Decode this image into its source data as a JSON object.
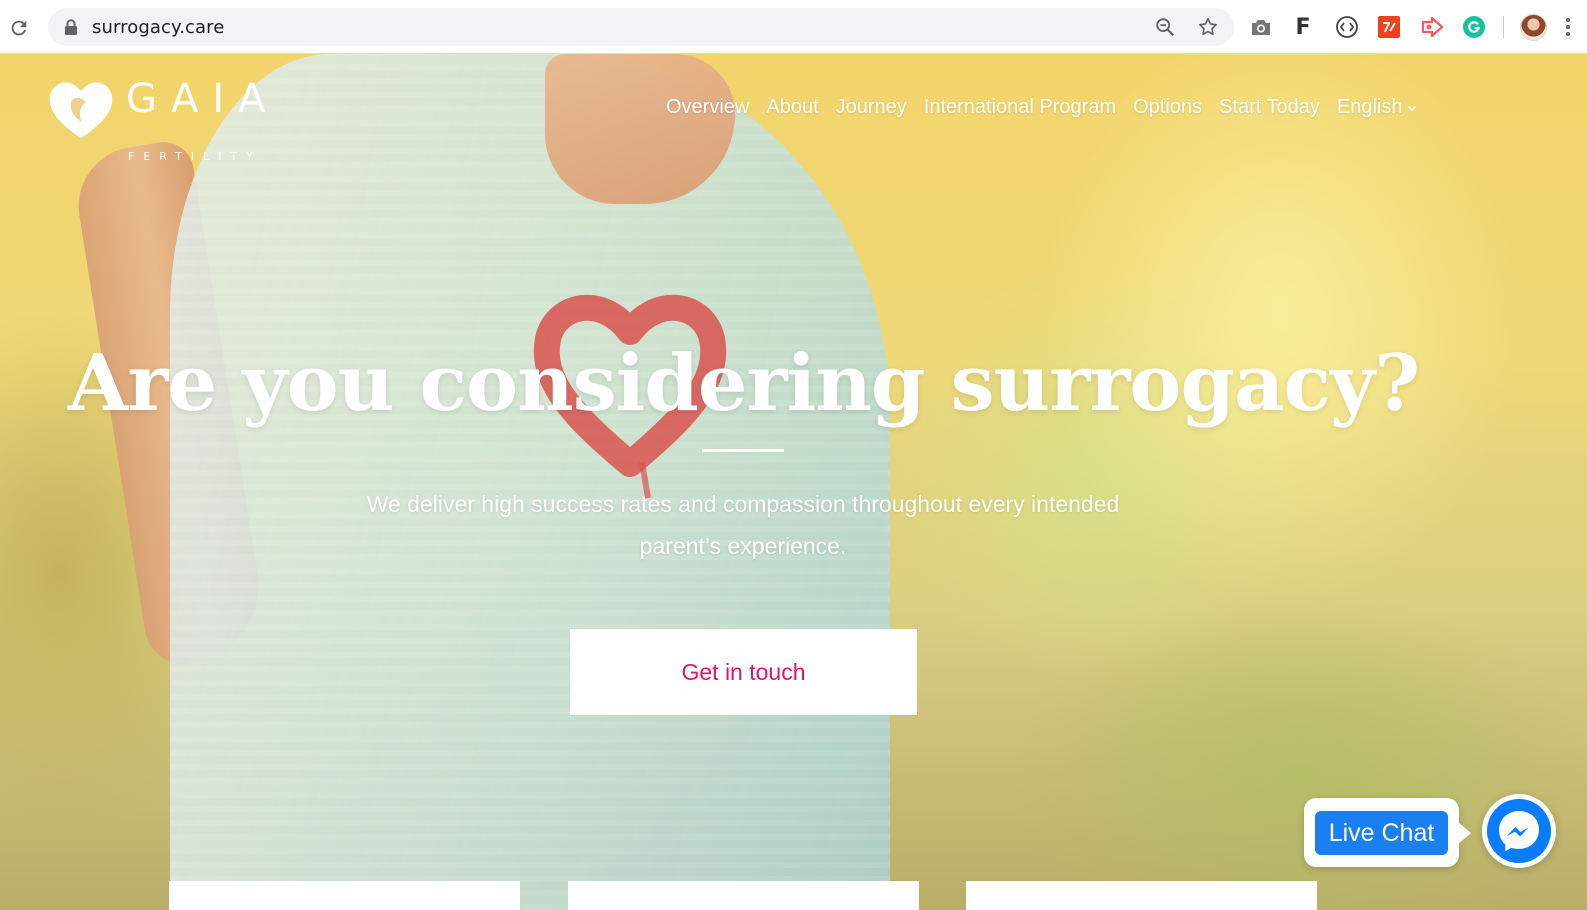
{
  "browser": {
    "url": "surrogacy.care",
    "icons": [
      "reload-icon",
      "lock-icon",
      "zoom-out-icon",
      "bookmark-star-icon",
      "camera-icon",
      "f-extension-icon",
      "code-extension-icon",
      "red-extension-icon",
      "arrow-extension-icon",
      "grammarly-icon",
      "profile-avatar",
      "menu-icon"
    ],
    "extension_f_label": "F"
  },
  "site": {
    "logo": {
      "name": "GAIA",
      "tagline": "FERTILITY"
    },
    "nav": {
      "items": [
        "Overview",
        "About",
        "Journey",
        "International Program",
        "Options",
        "Start Today"
      ],
      "language": "English"
    },
    "hero": {
      "headline": "Are you considering surrogacy?",
      "subtext": "We deliver high success rates and compassion throughout every intended parent’s experience.",
      "cta": "Get in touch"
    },
    "chat": {
      "live_chat_label": "Live Chat"
    }
  },
  "colors": {
    "cta_text": "#e3136b",
    "live_chat_blue": "#1a7ff0",
    "messenger_blue": "#0a7cff"
  }
}
